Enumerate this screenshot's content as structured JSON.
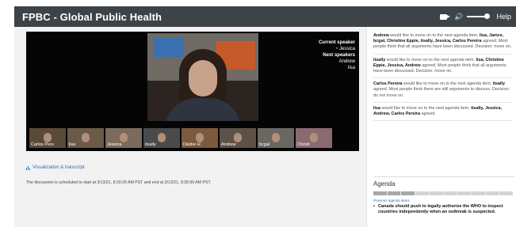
{
  "app": {
    "title": "FPBC - Global Public Health",
    "help_label": "Help"
  },
  "video": {
    "current_speaker_label": "Current speaker",
    "current_speaker": "Jessica",
    "next_speakers_label": "Next speakers",
    "next_speakers": [
      "Andrew",
      "lisa"
    ],
    "participants": [
      {
        "name": "Carlos Pere",
        "bg": "#5a4a3a"
      },
      {
        "name": "lisa",
        "bg": "#6b5a48"
      },
      {
        "name": "Jessica",
        "bg": "#7a6b5c"
      },
      {
        "name": "itsally",
        "bg": "#4a4a4a"
      },
      {
        "name": "Deidre H",
        "bg": "#7b5a3e"
      },
      {
        "name": "Andrew",
        "bg": "#5e5248"
      },
      {
        "name": "bcgal",
        "bg": "#6a6660"
      },
      {
        "name": "Christi",
        "bg": "#8a6a70"
      }
    ]
  },
  "links": {
    "visualization": "Visualization & transcript"
  },
  "schedule_text": "The discussion is scheduled to start at 3/13/21, 8:20:20 AM PST and end at 3/13/21, 9:30:00 AM PST.",
  "transcript": [
    {
      "speaker": "Andrew",
      "text": " would like to move on to the next agenda item. ",
      "agreers": "lisa, Janice, bcgal, Christine Eppie, itsally, Jessica, Carlos Pereira",
      "tail": " agreed. Most people think that all arguments have been discussed. Decision: move on."
    },
    {
      "speaker": "itsally",
      "text": " would like to move on to the next agenda item. ",
      "agreers": "lisa, Christine Eppie, Jessica, Andrew",
      "tail": " agreed. Most people think that all arguments have been discussed. Decision: move on."
    },
    {
      "speaker": "Carlos Pereira",
      "text": " would like to move on to the next agenda item. ",
      "agreers": "itsally",
      "tail": " agreed. Most people think there are still arguments to discuss. Decision: do not move on."
    },
    {
      "speaker": "lisa",
      "text": " would like to move on to the next agenda item. ",
      "agreers": "itsally, Jessica, Andrew, Carlos Pereira",
      "tail": " agreed."
    }
  ],
  "agenda": {
    "title": "Agenda",
    "segments": 10,
    "completed_segments": 3,
    "previous_label": "Previous agenda items",
    "current_item": "Canada should push to legally authorize the WHO to inspect countries independently when an outbreak is suspected."
  }
}
